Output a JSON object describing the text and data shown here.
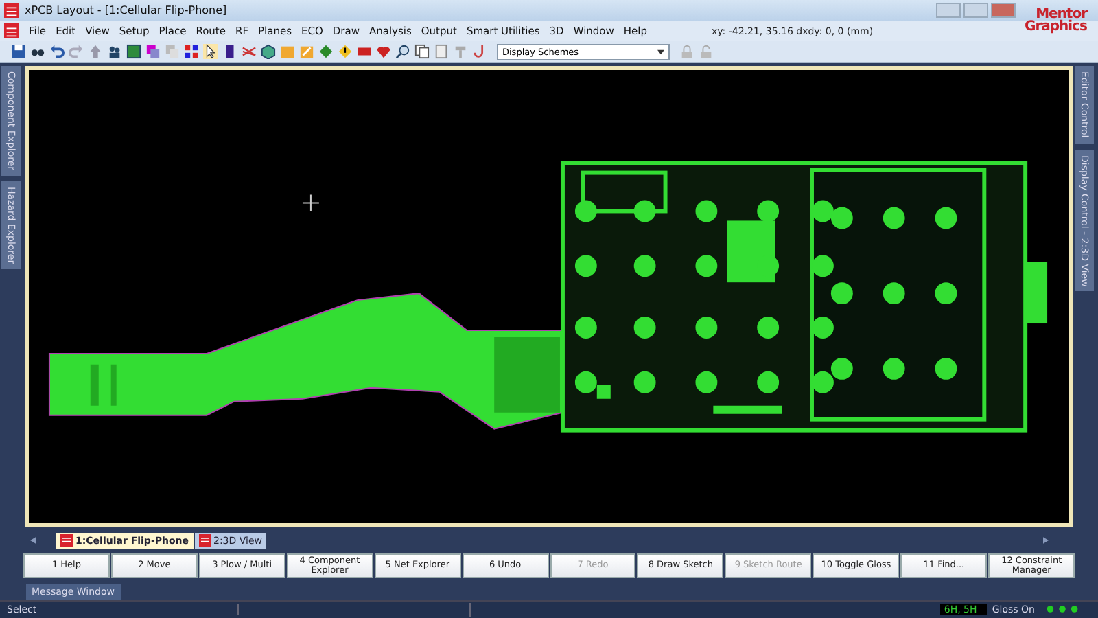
{
  "window": {
    "title": "xPCB Layout   - [1:Cellular Flip-Phone]"
  },
  "menu": [
    "File",
    "Edit",
    "View",
    "Setup",
    "Place",
    "Route",
    "RF",
    "Planes",
    "ECO",
    "Draw",
    "Analysis",
    "Output",
    "Smart Utilities",
    "3D",
    "Window",
    "Help"
  ],
  "coordinates": "xy: -42.21, 35.16  dxdy: 0, 0  (mm)",
  "logo": [
    "Mentor",
    "Graphics"
  ],
  "toolbar": {
    "scheme_dropdown": "Display Schemes"
  },
  "left_panels": [
    {
      "label": "Component Explorer"
    },
    {
      "label": "Hazard Explorer"
    }
  ],
  "right_panels": [
    {
      "label": "Editor Control"
    },
    {
      "label": "Display Control - 2:3D View"
    }
  ],
  "document_tabs": [
    {
      "label": "1:Cellular Flip-Phone",
      "selected": true
    },
    {
      "label": "2:3D View",
      "selected": false
    }
  ],
  "function_keys": [
    {
      "label": "1 Help",
      "disabled": false
    },
    {
      "label": "2 Move",
      "disabled": false
    },
    {
      "label": "3 Plow / Multi",
      "disabled": false
    },
    {
      "label": "4 Component Explorer",
      "disabled": false
    },
    {
      "label": "5 Net Explorer",
      "disabled": false
    },
    {
      "label": "6 Undo",
      "disabled": false
    },
    {
      "label": "7 Redo",
      "disabled": true
    },
    {
      "label": "8 Draw Sketch",
      "disabled": false
    },
    {
      "label": "9 Sketch Route",
      "disabled": true
    },
    {
      "label": "10 Toggle Gloss",
      "disabled": false
    },
    {
      "label": "11 Find...",
      "disabled": false
    },
    {
      "label": "12 Constraint Manager",
      "disabled": false
    }
  ],
  "message_tab": "Message Window",
  "status_bar": {
    "mode": "Select",
    "layers": "6H, 5H",
    "gloss": "Gloss On"
  }
}
